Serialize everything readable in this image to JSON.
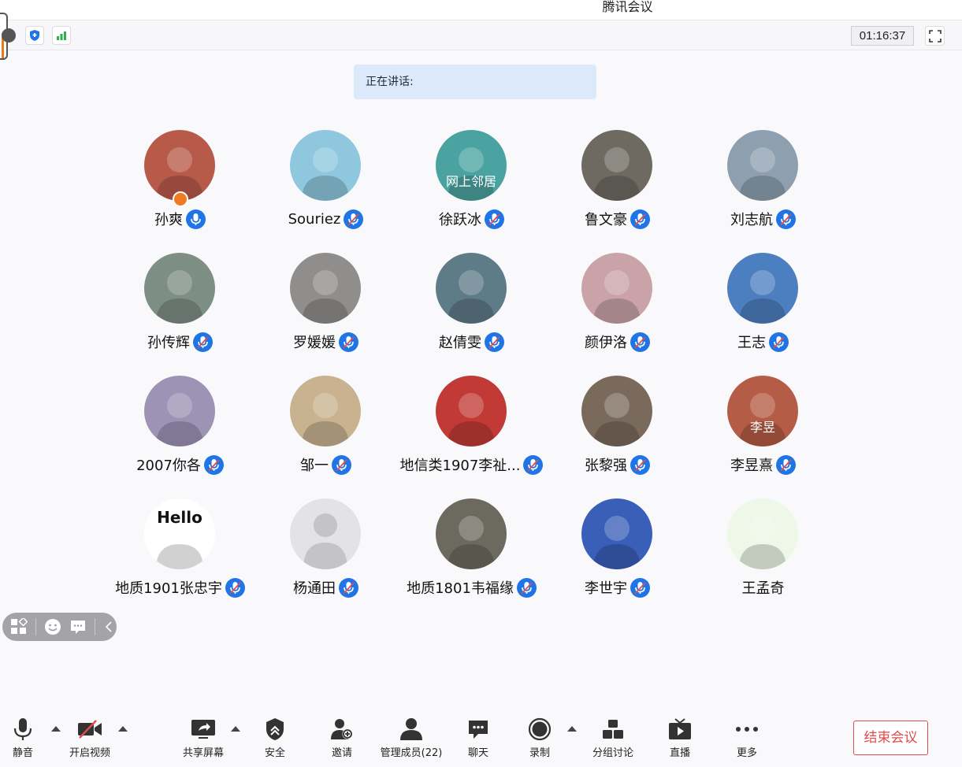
{
  "window": {
    "title": "腾讯会议"
  },
  "status": {
    "timer": "01:16:37"
  },
  "speaking": {
    "label": "正在讲话:"
  },
  "participants": [
    {
      "name": "孙爽",
      "mic": "on",
      "host": true,
      "bg": "#b85a4a"
    },
    {
      "name": "Souriez",
      "mic": "off",
      "bg": "#8fc7df"
    },
    {
      "name": "徐跃冰",
      "mic": "off",
      "bg": "#4aa3a0",
      "avatar_text": "网上邻居"
    },
    {
      "name": "鲁文豪",
      "mic": "off",
      "bg": "#6e6a62"
    },
    {
      "name": "刘志航",
      "mic": "off",
      "bg": "#8ea0b0"
    },
    {
      "name": "孙传辉",
      "mic": "off",
      "bg": "#7d8e85"
    },
    {
      "name": "罗媛媛",
      "mic": "off",
      "bg": "#8f8e8c"
    },
    {
      "name": "赵倩雯",
      "mic": "off",
      "bg": "#5e7b88"
    },
    {
      "name": "颜伊洛",
      "mic": "off",
      "bg": "#c9a3a8"
    },
    {
      "name": "王志",
      "mic": "off",
      "bg": "#4c7fbf"
    },
    {
      "name": "2007你各",
      "mic": "off",
      "bg": "#9d93b5"
    },
    {
      "name": "邹一",
      "mic": "off",
      "bg": "#c9b290"
    },
    {
      "name": "地信类1907李祉...",
      "mic": "off",
      "bg": "#c23a35"
    },
    {
      "name": "张黎强",
      "mic": "off",
      "bg": "#7a6a5c"
    },
    {
      "name": "李昱熹",
      "mic": "off",
      "bg": "#b45c45",
      "avatar_text": "李昱"
    },
    {
      "name": "地质1901张忠宇",
      "mic": "off",
      "bg": "#ffffff",
      "avatar_text": "Hello"
    },
    {
      "name": "杨通田",
      "mic": "off",
      "bg": "#e3e3e5"
    },
    {
      "name": "地质1801韦福缘",
      "mic": "off",
      "bg": "#6c6a5e"
    },
    {
      "name": "李世宇",
      "mic": "off",
      "bg": "#3a5fb8"
    },
    {
      "name": "王孟奇",
      "mic": "none",
      "bg": "#eef8e8"
    }
  ],
  "toolbar": {
    "mute": "静音",
    "video": "开启视频",
    "share": "共享屏幕",
    "security": "安全",
    "invite": "邀请",
    "members": "管理成员(22)",
    "chat": "聊天",
    "record": "录制",
    "breakout": "分组讨论",
    "live": "直播",
    "more": "更多",
    "end": "结束会议"
  },
  "colors": {
    "accent": "#1f74e6",
    "end": "#e04b4b",
    "host_badge": "#f07a22"
  }
}
